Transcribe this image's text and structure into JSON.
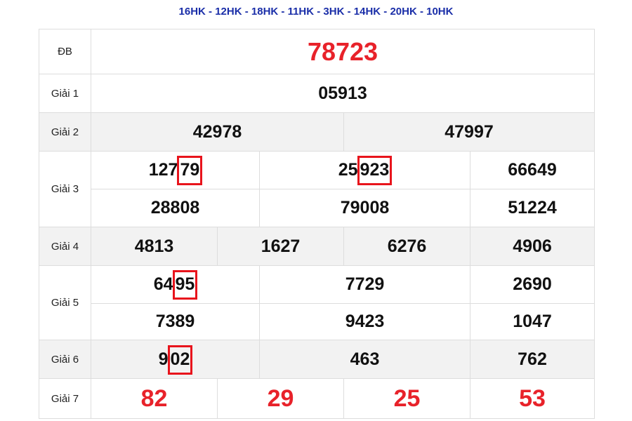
{
  "header": {
    "codes": "16HK - 12HK - 18HK - 11HK - 3HK - 14HK - 20HK - 10HK"
  },
  "colors": {
    "highlight_border": "#e8141c",
    "special_number": "#e8222a",
    "codes_text": "#1a2ea8"
  },
  "prizes": {
    "db": {
      "label": "ĐB",
      "value": "78723"
    },
    "g1": {
      "label": "Giải 1",
      "value": "05913"
    },
    "g2": {
      "label": "Giải 2",
      "values": [
        "42978",
        "47997"
      ]
    },
    "g3": {
      "label": "Giải 3",
      "row1": [
        {
          "pre": "127",
          "hl": "79"
        },
        {
          "pre": "25",
          "hl": "923"
        },
        {
          "pre": "66649",
          "hl": ""
        }
      ],
      "row2": [
        "28808",
        "79008",
        "51224"
      ]
    },
    "g4": {
      "label": "Giải 4",
      "values": [
        "4813",
        "1627",
        "6276",
        "4906"
      ]
    },
    "g5": {
      "label": "Giải 5",
      "row1": [
        {
          "pre": "64",
          "hl": "95"
        },
        {
          "pre": "7729",
          "hl": ""
        },
        {
          "pre": "2690",
          "hl": ""
        }
      ],
      "row2": [
        "7389",
        "9423",
        "1047"
      ]
    },
    "g6": {
      "label": "Giải 6",
      "values": [
        {
          "pre": "9",
          "hl": "02"
        },
        {
          "pre": "463",
          "hl": ""
        },
        {
          "pre": "762",
          "hl": ""
        }
      ]
    },
    "g7": {
      "label": "Giải 7",
      "values": [
        "82",
        "29",
        "25",
        "53"
      ]
    }
  }
}
